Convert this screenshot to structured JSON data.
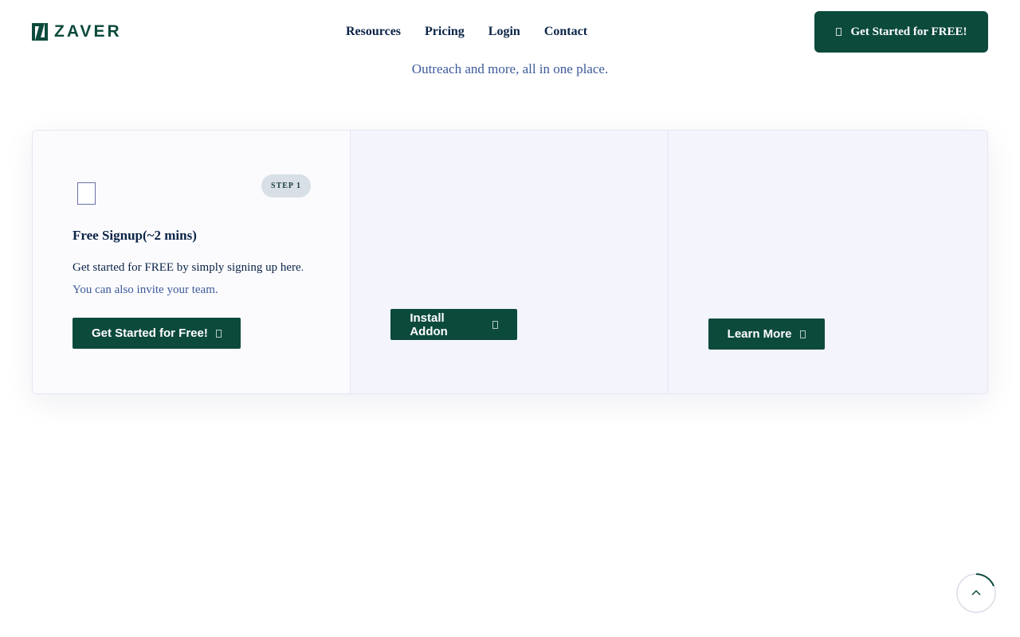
{
  "brand": {
    "name": "ZAVER",
    "color": "#0c4a3c"
  },
  "nav": {
    "items": [
      {
        "label": "Resources"
      },
      {
        "label": "Pricing"
      },
      {
        "label": "Login"
      },
      {
        "label": "Contact"
      }
    ],
    "cta_label": "Get Started for FREE!"
  },
  "tagline": "Outreach and more, all in one place.",
  "steps": [
    {
      "badge": "STEP 1",
      "title": "Free Signup(~2 mins)",
      "desc_lead": "Get started for FREE by simply signing up",
      "desc_link": "here",
      "desc_tail": ". You can also invite your team.",
      "button": "Get Started for Free!"
    },
    {
      "button": "Install Addon"
    },
    {
      "button": "Learn More"
    }
  ],
  "icons": {
    "logo": "zaver-logo-icon",
    "cta": "arrow-icon",
    "step": "signup-icon",
    "scroll": "chevron-up-icon"
  },
  "colors": {
    "accent": "#0c4a3c",
    "navy": "#0b2447",
    "muted": "#3d5a99",
    "card_bg": "#f4f4fd",
    "badge_bg": "#d8dfe6"
  }
}
